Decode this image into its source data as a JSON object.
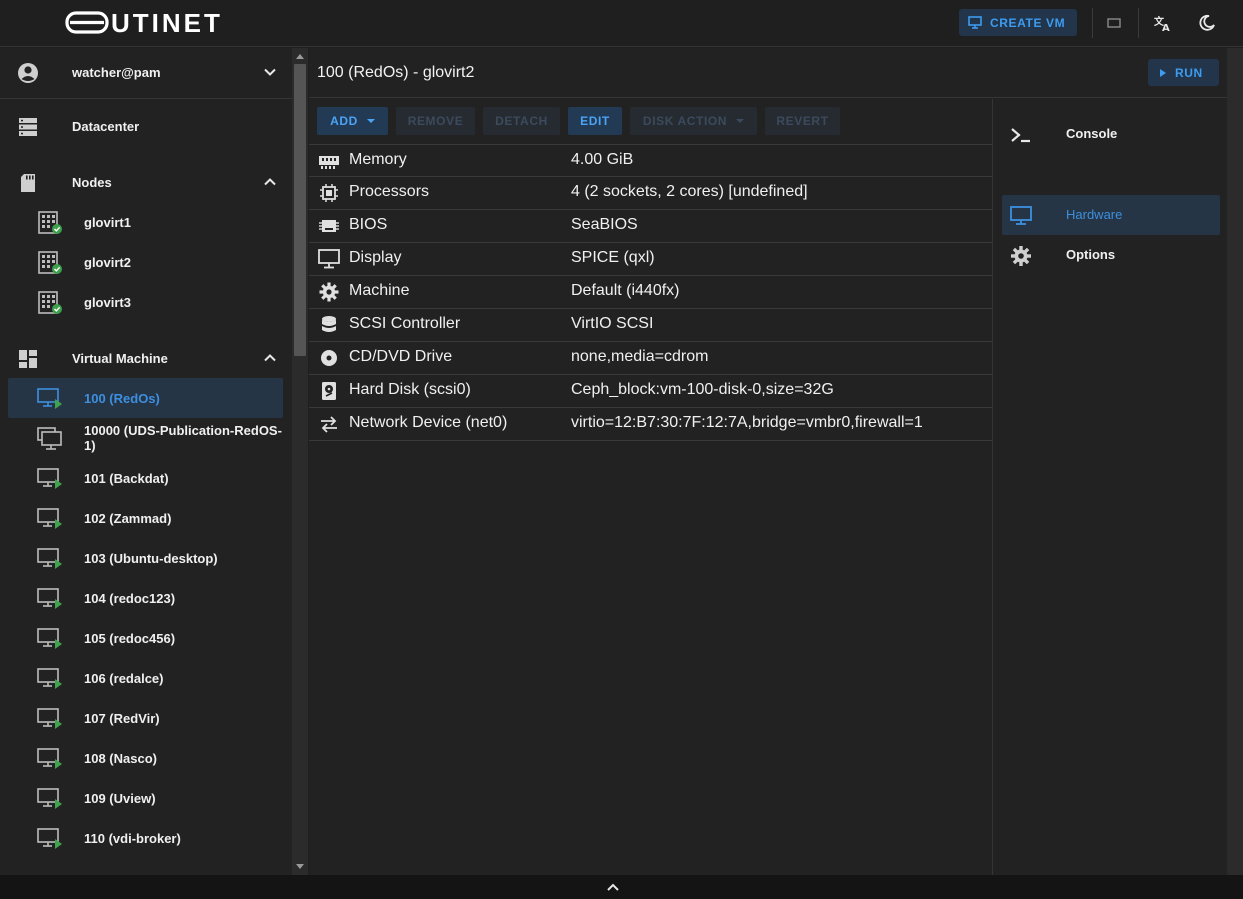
{
  "header": {
    "logo_text": "UTINET",
    "create_vm_label": "CREATE VM",
    "icons": [
      "monitor-icon",
      "window-icon",
      "translate-icon",
      "theme-toggle-icon"
    ]
  },
  "sidebar": {
    "user": {
      "label": "watcher@pam",
      "icon": "account-circle-icon"
    },
    "datacenter": {
      "label": "Datacenter",
      "icon": "server-stack-icon"
    },
    "nodes": {
      "label": "Nodes",
      "icon": "sd-card-icon",
      "items": [
        {
          "label": "glovirt1",
          "status": "online"
        },
        {
          "label": "glovirt2",
          "status": "online"
        },
        {
          "label": "glovirt3",
          "status": "online"
        }
      ]
    },
    "virtual_machines": {
      "label": "Virtual Machine",
      "icon": "dashboard-icon",
      "items": [
        {
          "label": "100 (RedOs)",
          "active": true,
          "kind": "vm-stopped"
        },
        {
          "label": "10000 (UDS-Publication-RedOS-1)",
          "kind": "vm-template"
        },
        {
          "label": "101 (Backdat)",
          "kind": "vm-running"
        },
        {
          "label": "102 (Zammad)",
          "kind": "vm-running"
        },
        {
          "label": "103 (Ubuntu-desktop)",
          "kind": "vm-running"
        },
        {
          "label": "104 (redoc123)",
          "kind": "vm-running"
        },
        {
          "label": "105 (redoc456)",
          "kind": "vm-running"
        },
        {
          "label": "106 (redalce)",
          "kind": "vm-running"
        },
        {
          "label": "107 (RedVir)",
          "kind": "vm-running"
        },
        {
          "label": "108 (Nasco)",
          "kind": "vm-running"
        },
        {
          "label": "109 (Uview)",
          "kind": "vm-running"
        },
        {
          "label": "110 (vdi-broker)",
          "kind": "vm-running"
        }
      ]
    }
  },
  "main": {
    "title": "100 (RedOs) - glovirt2",
    "run_label": "RUN",
    "toolbar": {
      "add": "ADD",
      "remove": "REMOVE",
      "detach": "DETACH",
      "edit": "EDIT",
      "disk_action": "DISK ACTION",
      "revert": "REVERT"
    },
    "hardware": [
      {
        "icon": "memory-icon",
        "name": "Memory",
        "value": "4.00 GiB"
      },
      {
        "icon": "cpu-icon",
        "name": "Processors",
        "value": "4 (2 sockets, 2 cores) [undefined]"
      },
      {
        "icon": "bios-chip-icon",
        "name": "BIOS",
        "value": "SeaBIOS"
      },
      {
        "icon": "display-icon",
        "name": "Display",
        "value": "SPICE (qxl)"
      },
      {
        "icon": "gear-icon",
        "name": "Machine",
        "value": "Default (i440fx)"
      },
      {
        "icon": "database-icon",
        "name": "SCSI Controller",
        "value": "VirtIO SCSI"
      },
      {
        "icon": "disc-icon",
        "name": "CD/DVD Drive",
        "value": "none,media=cdrom"
      },
      {
        "icon": "hard-disk-icon",
        "name": "Hard Disk (scsi0)",
        "value": "Ceph_block:vm-100-disk-0,size=32G"
      },
      {
        "icon": "swap-arrows-icon",
        "name": "Network Device (net0)",
        "value": "virtio=12:B7:30:7F:12:7A,bridge=vmbr0,firewall=1"
      }
    ]
  },
  "right_panel": {
    "items": [
      {
        "icon": "console-icon",
        "label": "Console"
      },
      {
        "icon": "monitor-icon",
        "label": "Hardware",
        "active": true
      },
      {
        "icon": "gear-icon",
        "label": "Options"
      }
    ]
  },
  "colors": {
    "accent": "#3d9bf0",
    "running_badge": "#3fa34d",
    "background": "#222222"
  }
}
